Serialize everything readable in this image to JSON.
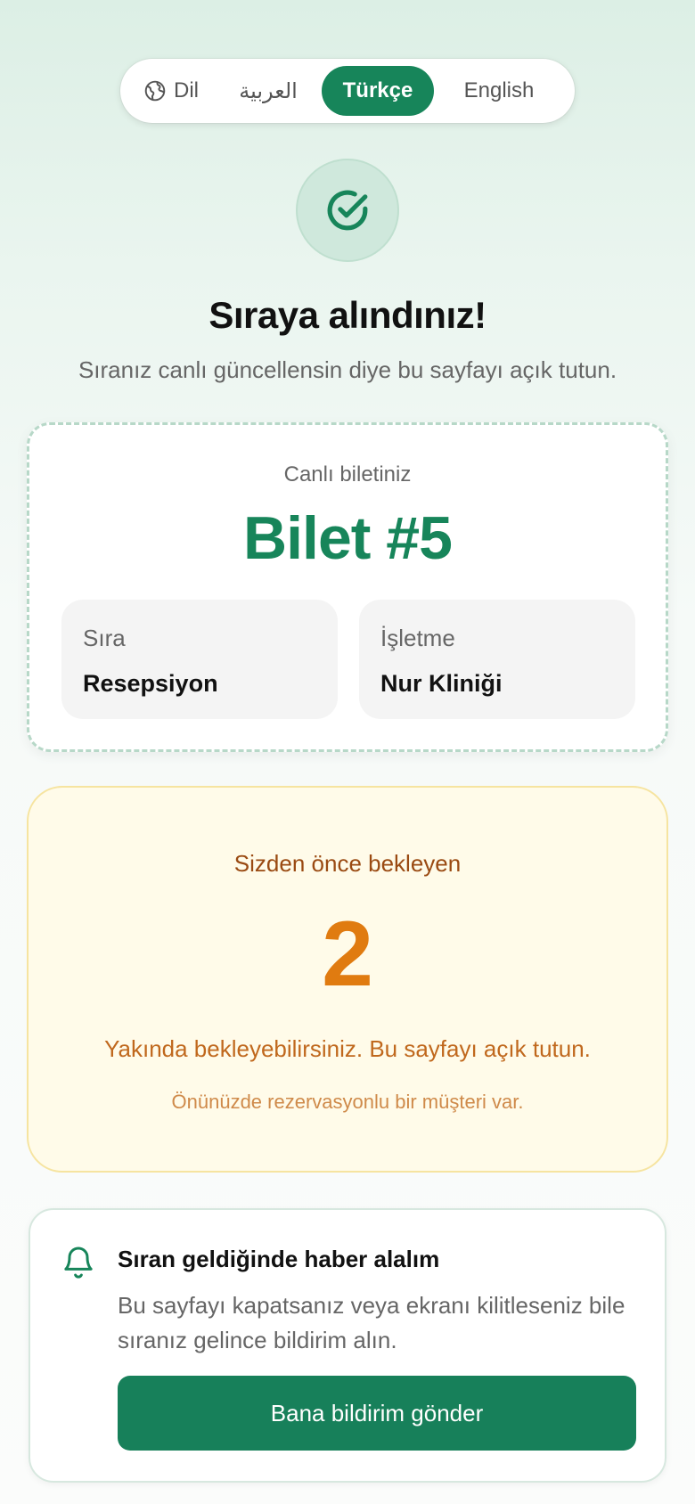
{
  "language": {
    "label": "Dil",
    "options": [
      {
        "code": "ar",
        "label": "العربية",
        "selected": false
      },
      {
        "code": "tr",
        "label": "Türkçe",
        "selected": true
      },
      {
        "code": "en",
        "label": "English",
        "selected": false
      }
    ]
  },
  "status": {
    "icon": "check-circle-icon",
    "title": "Sıraya alındınız!",
    "subtitle": "Sıranız canlı güncellensin diye bu sayfayı açık tutun."
  },
  "ticket": {
    "label": "Canlı biletiniz",
    "number": "Bilet #5",
    "queue_title": "Sıra",
    "queue_value": "Resepsiyon",
    "business_title": "İşletme",
    "business_value": "Nur Kliniği"
  },
  "waiting": {
    "label": "Sizden önce bekleyen",
    "count": "2",
    "message": "Yakında bekleyebilirsiniz. Bu sayfayı açık tutun.",
    "note": "Önünüzde rezervasyonlu bir müşteri var."
  },
  "notify": {
    "icon": "bell-icon",
    "title": "Sıran geldiğinde haber alalım",
    "description": "Bu sayfayı kapatsanız veya ekranı kilitleseniz bile sıranız gelince bildirim alın.",
    "button_label": "Bana bildirim gönder"
  },
  "colors": {
    "accent": "#17855a",
    "warning_text": "#e07b10",
    "warning_bg": "#fffbe9"
  }
}
